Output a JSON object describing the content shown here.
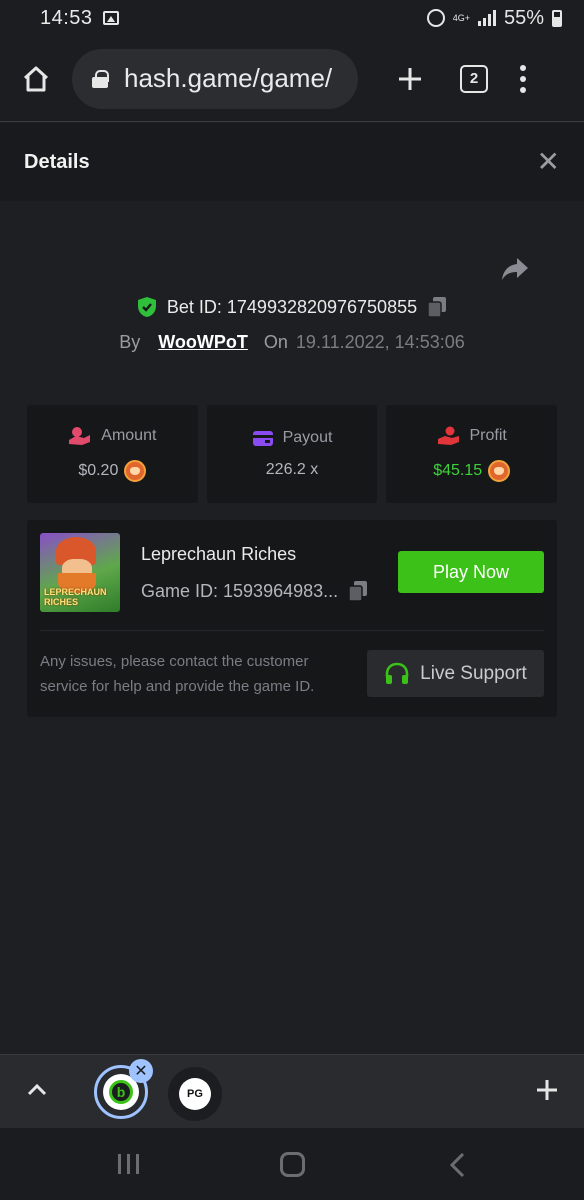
{
  "status_bar": {
    "time": "14:53",
    "network": "4G+",
    "battery": "55%"
  },
  "browser": {
    "url": "hash.game/game/",
    "tab_count": "2"
  },
  "details": {
    "title": "Details"
  },
  "bet": {
    "bet_id_label": "Bet ID: 1749932820976750855",
    "by_label": "By",
    "user": "WooWPoT",
    "on_label": "On",
    "date": "19.11.2022, 14:53:06"
  },
  "stats": {
    "amount": {
      "label": "Amount",
      "value": "$0.20"
    },
    "payout": {
      "label": "Payout",
      "value": "226.2 x"
    },
    "profit": {
      "label": "Profit",
      "value": "$45.15"
    }
  },
  "game": {
    "thumb_text": "LEPRECHAUN RICHES",
    "name": "Leprechaun Riches",
    "game_id": "Game ID: 1593964983...",
    "play_label": "Play Now",
    "issue_text": "Any issues, please contact the customer service for help and provide the game ID.",
    "support_label": "Live Support"
  },
  "tabstrip": {
    "tab2_label": "PG"
  },
  "colors": {
    "accent_green": "#3bc117",
    "profit_green": "#3dd13a",
    "background": "#1e1f22"
  },
  "icons": [
    "image-icon",
    "alarm-icon",
    "signal-icon",
    "battery-icon",
    "home-icon",
    "lock-icon",
    "plus-icon",
    "menu-icon",
    "close-icon",
    "share-icon",
    "shield-check-icon",
    "copy-icon",
    "coin-icon",
    "wallet-icon",
    "hand-coin-icon",
    "headset-icon",
    "chevron-up-icon"
  ]
}
